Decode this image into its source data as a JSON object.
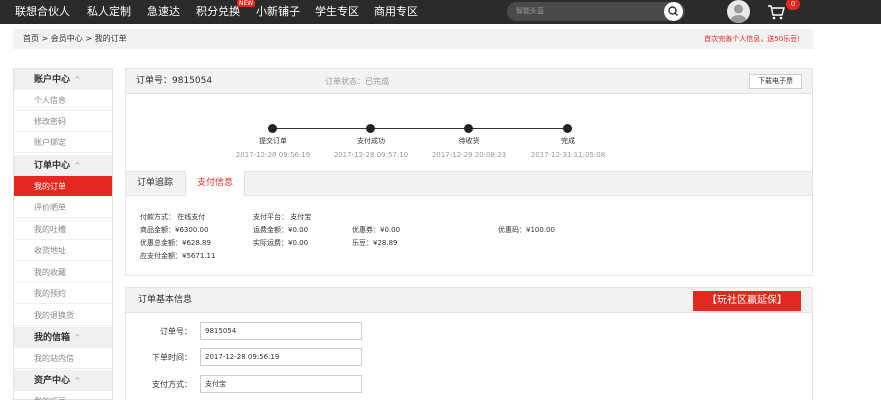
{
  "nav": {
    "items": [
      "联想合伙人",
      "私人定制",
      "急速达",
      "积分兑换",
      "小新铺子",
      "学生专区",
      "商用专区"
    ],
    "new_badge": "NEW",
    "search_placeholder": "智能头盔",
    "cart_count": "0"
  },
  "breadcrumb": "首页 > 会员中心 > 我的订单",
  "promo": "首次完善个人信息，送50乐豆!",
  "sidebar": [
    {
      "label": "账户中心",
      "type": "head"
    },
    {
      "label": "个人信息",
      "type": "item"
    },
    {
      "label": "修改密码",
      "type": "item"
    },
    {
      "label": "账户绑定",
      "type": "item"
    },
    {
      "label": "订单中心",
      "type": "head"
    },
    {
      "label": "我的订单",
      "type": "active"
    },
    {
      "label": "评价晒单",
      "type": "item"
    },
    {
      "label": "我的吐槽",
      "type": "item"
    },
    {
      "label": "收货地址",
      "type": "item"
    },
    {
      "label": "我的收藏",
      "type": "item"
    },
    {
      "label": "我的预约",
      "type": "item"
    },
    {
      "label": "我的退换货",
      "type": "item"
    },
    {
      "label": "我的信箱",
      "type": "head"
    },
    {
      "label": "我的站内信",
      "type": "item"
    },
    {
      "label": "资产中心",
      "type": "head"
    },
    {
      "label": "我的乐豆",
      "type": "item"
    }
  ],
  "order": {
    "number_label": "订单号：9815054",
    "status_label": "订单状态：已完成",
    "download_label": "下载电子票",
    "timeline": [
      {
        "label": "提交订单",
        "time": "2017-12-28 09:56:19"
      },
      {
        "label": "支付成功",
        "time": "2017-12-28 09:57:10"
      },
      {
        "label": "待收货",
        "time": "2017-12-29 20:08:23"
      },
      {
        "label": "完成",
        "time": "2017-12-31 11:05:08"
      }
    ],
    "tabs": [
      "订单追踪",
      "支付信息"
    ],
    "payment": {
      "method": "付款方式：  在线支付",
      "platform": "支付平台：  支付宝",
      "goods": "商品金额：¥6300.00",
      "shipping": "运费金额：¥0.00",
      "coupon": "优惠券：¥0.00",
      "code": "优惠码：¥100.00",
      "discount": "优惠总金额：¥628.89",
      "actual_shipping": "实际运费：¥0.00",
      "ledou": "乐豆：¥28.89",
      "payable": "应支付金额：¥5671.11"
    }
  },
  "basic_info": {
    "title": "订单基本信息",
    "badge": "【玩社区赢延保】",
    "fields": [
      {
        "label": "订单号：",
        "value": "9815054"
      },
      {
        "label": "下单时间：",
        "value": "2017-12-28 09:56:19"
      },
      {
        "label": "支付方式：",
        "value": "支付宝"
      }
    ]
  },
  "colors": {
    "accent": "#e4281f",
    "nav_bg": "#2b2b2b"
  }
}
